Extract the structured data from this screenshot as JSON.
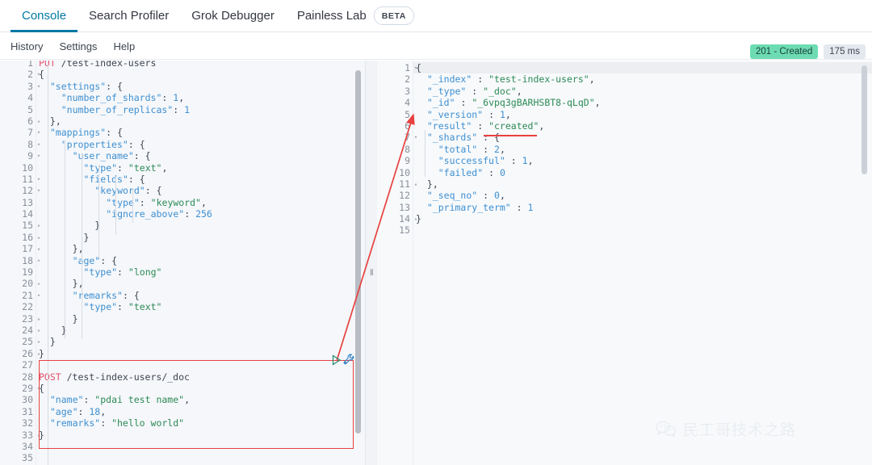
{
  "app": {
    "name": "Kibana Dev Tools Console"
  },
  "tabs": [
    {
      "label": "Console",
      "active": true,
      "badge": null
    },
    {
      "label": "Search Profiler",
      "active": false,
      "badge": null
    },
    {
      "label": "Grok Debugger",
      "active": false,
      "badge": null
    },
    {
      "label": "Painless Lab",
      "active": false,
      "badge": "BETA"
    }
  ],
  "subbar": {
    "items": [
      {
        "label": "History"
      },
      {
        "label": "Settings"
      },
      {
        "label": "Help"
      }
    ]
  },
  "status": {
    "response_code": "201 - Created",
    "response_time": "175 ms",
    "success_color": "#6edcb3",
    "time_color": "#e4e8ef"
  },
  "request_editor": {
    "name": "console-request-editor",
    "first_visible_line": 1,
    "total_lines": 35,
    "lines": [
      {
        "n": 1,
        "fold": "",
        "text": "PUT /test-index-users",
        "method": "PUT",
        "url": "/test-index-users"
      },
      {
        "n": 2,
        "fold": "▾",
        "text": "{"
      },
      {
        "n": 3,
        "fold": "▾",
        "text": "  \"settings\": {"
      },
      {
        "n": 4,
        "fold": "",
        "text": "    \"number_of_shards\": 1,"
      },
      {
        "n": 5,
        "fold": "",
        "text": "    \"number_of_replicas\": 1"
      },
      {
        "n": 6,
        "fold": "▴",
        "text": "  },"
      },
      {
        "n": 7,
        "fold": "▾",
        "text": "  \"mappings\": {"
      },
      {
        "n": 8,
        "fold": "▾",
        "text": "    \"properties\": {"
      },
      {
        "n": 9,
        "fold": "▾",
        "text": "      \"user_name\": {"
      },
      {
        "n": 10,
        "fold": "",
        "text": "        \"type\": \"text\","
      },
      {
        "n": 11,
        "fold": "▾",
        "text": "        \"fields\": {"
      },
      {
        "n": 12,
        "fold": "▾",
        "text": "          \"keyword\": {"
      },
      {
        "n": 13,
        "fold": "",
        "text": "            \"type\": \"keyword\","
      },
      {
        "n": 14,
        "fold": "",
        "text": "            \"ignore_above\": 256"
      },
      {
        "n": 15,
        "fold": "▴",
        "text": "          }"
      },
      {
        "n": 16,
        "fold": "▴",
        "text": "        }"
      },
      {
        "n": 17,
        "fold": "▴",
        "text": "      },"
      },
      {
        "n": 18,
        "fold": "▾",
        "text": "      \"age\": {"
      },
      {
        "n": 19,
        "fold": "",
        "text": "        \"type\": \"long\""
      },
      {
        "n": 20,
        "fold": "▴",
        "text": "      },"
      },
      {
        "n": 21,
        "fold": "▾",
        "text": "      \"remarks\": {"
      },
      {
        "n": 22,
        "fold": "",
        "text": "        \"type\": \"text\""
      },
      {
        "n": 23,
        "fold": "▴",
        "text": "      }"
      },
      {
        "n": 24,
        "fold": "▴",
        "text": "    }"
      },
      {
        "n": 25,
        "fold": "▴",
        "text": "  }"
      },
      {
        "n": 26,
        "fold": "▴",
        "text": "}"
      },
      {
        "n": 27,
        "fold": "",
        "text": ""
      },
      {
        "n": 28,
        "fold": "",
        "text": "POST /test-index-users/_doc",
        "method": "POST",
        "url": "/test-index-users/_doc"
      },
      {
        "n": 29,
        "fold": "▾",
        "text": "{"
      },
      {
        "n": 30,
        "fold": "",
        "text": "  \"name\": \"pdai test name\","
      },
      {
        "n": 31,
        "fold": "",
        "text": "  \"age\": 18,"
      },
      {
        "n": 32,
        "fold": "",
        "text": "  \"remarks\": \"hello world\""
      },
      {
        "n": 33,
        "fold": "▴",
        "text": "}"
      },
      {
        "n": 34,
        "fold": "",
        "text": ""
      },
      {
        "n": 35,
        "fold": "",
        "text": ""
      }
    ]
  },
  "response_editor": {
    "name": "console-response-editor",
    "total_lines": 15,
    "lines": [
      {
        "n": 1,
        "fold": "▾",
        "text": "{"
      },
      {
        "n": 2,
        "fold": "",
        "text": "  \"_index\" : \"test-index-users\","
      },
      {
        "n": 3,
        "fold": "",
        "text": "  \"_type\" : \"_doc\","
      },
      {
        "n": 4,
        "fold": "",
        "text": "  \"_id\" : \"_6vpq3gBARHSBT8-qLqD\","
      },
      {
        "n": 5,
        "fold": "",
        "text": "  \"_version\" : 1,"
      },
      {
        "n": 6,
        "fold": "",
        "text": "  \"result\" : \"created\","
      },
      {
        "n": 7,
        "fold": "▾",
        "text": "  \"_shards\" : {"
      },
      {
        "n": 8,
        "fold": "",
        "text": "    \"total\" : 2,"
      },
      {
        "n": 9,
        "fold": "",
        "text": "    \"successful\" : 1,"
      },
      {
        "n": 10,
        "fold": "",
        "text": "    \"failed\" : 0"
      },
      {
        "n": 11,
        "fold": "▴",
        "text": "  },"
      },
      {
        "n": 12,
        "fold": "",
        "text": "  \"_seq_no\" : 0,"
      },
      {
        "n": 13,
        "fold": "",
        "text": "  \"_primary_term\" : 1"
      },
      {
        "n": 14,
        "fold": "▴",
        "text": "}"
      },
      {
        "n": 15,
        "fold": "",
        "text": ""
      }
    ]
  },
  "annotations": {
    "highlight_color": "#e8413f",
    "request_box_label": "highlighted-request-block",
    "arrow_label": "request-to-response-arrow",
    "underline_label": "result-created-underline"
  },
  "actions": {
    "play_icon": "play-triangle-icon",
    "wrench_icon": "wrench-icon"
  },
  "watermark": {
    "text": "民工哥技术之路",
    "icon": "wechat-icon"
  }
}
